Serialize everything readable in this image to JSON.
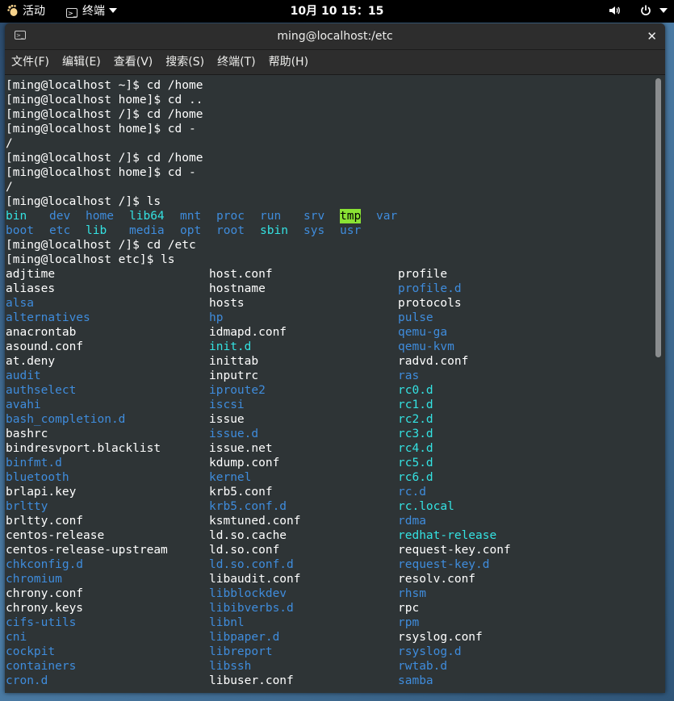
{
  "topbar": {
    "activities": "活动",
    "app_name": "终端",
    "clock": "10月 10  15：15",
    "icons": [
      "gnome-foot-icon",
      "terminal-app-icon",
      "volume-icon",
      "power-icon"
    ]
  },
  "window": {
    "title": "ming@localhost:/etc",
    "close": "✕"
  },
  "menubar": [
    "文件(F)",
    "编辑(E)",
    "查看(V)",
    "搜索(S)",
    "终端(T)",
    "帮助(H)"
  ],
  "colors": {
    "dir": "#3f8cdc",
    "link": "#34e2e2",
    "text": "#ffffff",
    "tmp_highlight": "#8ae234",
    "bg": "#2e3436"
  },
  "commands": [
    "[ming@localhost ~]$ cd /home",
    "[ming@localhost home]$ cd ..",
    "[ming@localhost /]$ cd /home",
    "[ming@localhost home]$ cd -",
    "/",
    "[ming@localhost /]$ cd /home",
    "[ming@localhost home]$ cd -",
    "/",
    "[ming@localhost /]$ ls"
  ],
  "root_ls": [
    [
      {
        "t": "bin",
        "k": "cyan"
      },
      {
        "t": "dev",
        "k": "blue"
      },
      {
        "t": "home",
        "k": "blue"
      },
      {
        "t": "lib64",
        "k": "cyan"
      },
      {
        "t": "mnt",
        "k": "blue"
      },
      {
        "t": "proc",
        "k": "blue"
      },
      {
        "t": "run",
        "k": "blue"
      },
      {
        "t": "srv",
        "k": "blue"
      },
      {
        "t": "tmp",
        "k": "hl"
      },
      {
        "t": "var",
        "k": "blue"
      }
    ],
    [
      {
        "t": "boot",
        "k": "blue"
      },
      {
        "t": "etc",
        "k": "blue"
      },
      {
        "t": "lib",
        "k": "cyan"
      },
      {
        "t": "media",
        "k": "blue"
      },
      {
        "t": "opt",
        "k": "blue"
      },
      {
        "t": "root",
        "k": "blue"
      },
      {
        "t": "sbin",
        "k": "cyan"
      },
      {
        "t": "sys",
        "k": "blue"
      },
      {
        "t": "usr",
        "k": "blue"
      }
    ]
  ],
  "commands2": [
    "[ming@localhost /]$ cd /etc",
    "[ming@localhost etc]$ ls"
  ],
  "etc_ls": [
    [
      {
        "t": "adjtime",
        "k": "white"
      },
      {
        "t": "host.conf",
        "k": "white"
      },
      {
        "t": "profile",
        "k": "white"
      }
    ],
    [
      {
        "t": "aliases",
        "k": "white"
      },
      {
        "t": "hostname",
        "k": "white"
      },
      {
        "t": "profile.d",
        "k": "blue"
      }
    ],
    [
      {
        "t": "alsa",
        "k": "blue"
      },
      {
        "t": "hosts",
        "k": "white"
      },
      {
        "t": "protocols",
        "k": "white"
      }
    ],
    [
      {
        "t": "alternatives",
        "k": "blue"
      },
      {
        "t": "hp",
        "k": "blue"
      },
      {
        "t": "pulse",
        "k": "blue"
      }
    ],
    [
      {
        "t": "anacrontab",
        "k": "white"
      },
      {
        "t": "idmapd.conf",
        "k": "white"
      },
      {
        "t": "qemu-ga",
        "k": "blue"
      }
    ],
    [
      {
        "t": "asound.conf",
        "k": "white"
      },
      {
        "t": "init.d",
        "k": "cyan"
      },
      {
        "t": "qemu-kvm",
        "k": "blue"
      }
    ],
    [
      {
        "t": "at.deny",
        "k": "white"
      },
      {
        "t": "inittab",
        "k": "white"
      },
      {
        "t": "radvd.conf",
        "k": "white"
      }
    ],
    [
      {
        "t": "audit",
        "k": "blue"
      },
      {
        "t": "inputrc",
        "k": "white"
      },
      {
        "t": "ras",
        "k": "blue"
      }
    ],
    [
      {
        "t": "authselect",
        "k": "blue"
      },
      {
        "t": "iproute2",
        "k": "blue"
      },
      {
        "t": "rc0.d",
        "k": "cyan"
      }
    ],
    [
      {
        "t": "avahi",
        "k": "blue"
      },
      {
        "t": "iscsi",
        "k": "blue"
      },
      {
        "t": "rc1.d",
        "k": "cyan"
      }
    ],
    [
      {
        "t": "bash_completion.d",
        "k": "blue"
      },
      {
        "t": "issue",
        "k": "white"
      },
      {
        "t": "rc2.d",
        "k": "cyan"
      }
    ],
    [
      {
        "t": "bashrc",
        "k": "white"
      },
      {
        "t": "issue.d",
        "k": "blue"
      },
      {
        "t": "rc3.d",
        "k": "cyan"
      }
    ],
    [
      {
        "t": "bindresvport.blacklist",
        "k": "white"
      },
      {
        "t": "issue.net",
        "k": "white"
      },
      {
        "t": "rc4.d",
        "k": "cyan"
      }
    ],
    [
      {
        "t": "binfmt.d",
        "k": "blue"
      },
      {
        "t": "kdump.conf",
        "k": "white"
      },
      {
        "t": "rc5.d",
        "k": "cyan"
      }
    ],
    [
      {
        "t": "bluetooth",
        "k": "blue"
      },
      {
        "t": "kernel",
        "k": "blue"
      },
      {
        "t": "rc6.d",
        "k": "cyan"
      }
    ],
    [
      {
        "t": "brlapi.key",
        "k": "white"
      },
      {
        "t": "krb5.conf",
        "k": "white"
      },
      {
        "t": "rc.d",
        "k": "blue"
      }
    ],
    [
      {
        "t": "brltty",
        "k": "blue"
      },
      {
        "t": "krb5.conf.d",
        "k": "blue"
      },
      {
        "t": "rc.local",
        "k": "cyan"
      }
    ],
    [
      {
        "t": "brltty.conf",
        "k": "white"
      },
      {
        "t": "ksmtuned.conf",
        "k": "white"
      },
      {
        "t": "rdma",
        "k": "blue"
      }
    ],
    [
      {
        "t": "centos-release",
        "k": "white"
      },
      {
        "t": "ld.so.cache",
        "k": "white"
      },
      {
        "t": "redhat-release",
        "k": "cyan"
      }
    ],
    [
      {
        "t": "centos-release-upstream",
        "k": "white"
      },
      {
        "t": "ld.so.conf",
        "k": "white"
      },
      {
        "t": "request-key.conf",
        "k": "white"
      }
    ],
    [
      {
        "t": "chkconfig.d",
        "k": "blue"
      },
      {
        "t": "ld.so.conf.d",
        "k": "blue"
      },
      {
        "t": "request-key.d",
        "k": "blue"
      }
    ],
    [
      {
        "t": "chromium",
        "k": "blue"
      },
      {
        "t": "libaudit.conf",
        "k": "white"
      },
      {
        "t": "resolv.conf",
        "k": "white"
      }
    ],
    [
      {
        "t": "chrony.conf",
        "k": "white"
      },
      {
        "t": "libblockdev",
        "k": "blue"
      },
      {
        "t": "rhsm",
        "k": "blue"
      }
    ],
    [
      {
        "t": "chrony.keys",
        "k": "white"
      },
      {
        "t": "libibverbs.d",
        "k": "blue"
      },
      {
        "t": "rpc",
        "k": "white"
      }
    ],
    [
      {
        "t": "cifs-utils",
        "k": "blue"
      },
      {
        "t": "libnl",
        "k": "blue"
      },
      {
        "t": "rpm",
        "k": "blue"
      }
    ],
    [
      {
        "t": "cni",
        "k": "blue"
      },
      {
        "t": "libpaper.d",
        "k": "blue"
      },
      {
        "t": "rsyslog.conf",
        "k": "white"
      }
    ],
    [
      {
        "t": "cockpit",
        "k": "blue"
      },
      {
        "t": "libreport",
        "k": "blue"
      },
      {
        "t": "rsyslog.d",
        "k": "blue"
      }
    ],
    [
      {
        "t": "containers",
        "k": "blue"
      },
      {
        "t": "libssh",
        "k": "blue"
      },
      {
        "t": "rwtab.d",
        "k": "blue"
      }
    ],
    [
      {
        "t": "cron.d",
        "k": "blue"
      },
      {
        "t": "libuser.conf",
        "k": "white"
      },
      {
        "t": "samba",
        "k": "blue"
      }
    ]
  ]
}
